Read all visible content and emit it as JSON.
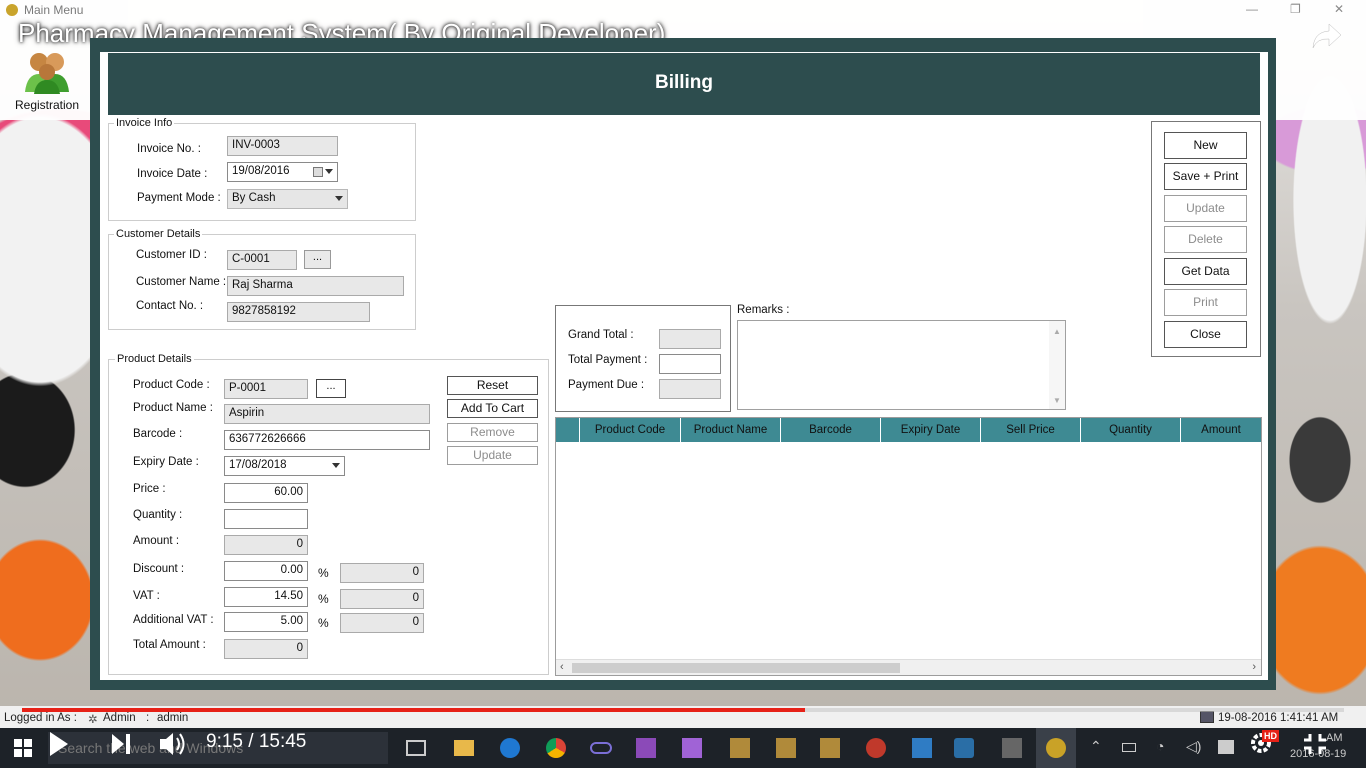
{
  "window": {
    "title": "Main Menu"
  },
  "video": {
    "title": "Pharmacy Management System( By Original Developer)",
    "time": "9:15 / 15:45",
    "hd_badge": "HD",
    "progress": 0.592
  },
  "toolbar": {
    "registration_label": "Registration"
  },
  "dialog": {
    "title": "Billing"
  },
  "invoice_info": {
    "group_title": "Invoice Info",
    "invoice_no_label": "Invoice No. :",
    "invoice_no": "INV-0003",
    "invoice_date_label": "Invoice Date :",
    "invoice_date": "19/08/2016",
    "payment_mode_label": "Payment Mode :",
    "payment_mode": "By Cash"
  },
  "customer_details": {
    "group_title": "Customer Details",
    "customer_id_label": "Customer ID :",
    "customer_id": "C-0001",
    "browse_label": "...",
    "customer_name_label": "Customer Name :",
    "customer_name": "Raj Sharma",
    "contact_label": "Contact No. :",
    "contact": "9827858192"
  },
  "product_details": {
    "group_title": "Product Details",
    "product_code_label": "Product Code :",
    "product_code": "P-0001",
    "browse_label": "...",
    "product_name_label": "Product Name :",
    "product_name": "Aspirin",
    "barcode_label": "Barcode :",
    "barcode": "636772626666",
    "expiry_label": "Expiry Date :",
    "expiry": "17/08/2018",
    "price_label": "Price :",
    "price": "60.00",
    "quantity_label": "Quantity :",
    "quantity": "",
    "amount_label": "Amount :",
    "amount": "0",
    "discount_label": "Discount :",
    "discount": "0.00",
    "discount_amt": "0",
    "vat_label": "VAT  :",
    "vat": "14.50",
    "vat_amt": "0",
    "addl_vat_label": "Additional VAT  :",
    "addl_vat": "5.00",
    "addl_vat_amt": "0",
    "total_label": "Total Amount :",
    "total": "0",
    "percent": "%",
    "reset_label": "Reset",
    "add_label": "Add To Cart",
    "remove_label": "Remove",
    "update_label": "Update"
  },
  "totals": {
    "grand_total_label": "Grand Total :",
    "grand_total": "",
    "total_payment_label": "Total Payment :",
    "total_payment": "",
    "payment_due_label": "Payment Due :",
    "payment_due": "",
    "remarks_label": "Remarks :"
  },
  "actions": {
    "new": "New",
    "save_print": "Save + Print",
    "update": "Update",
    "delete": "Delete",
    "get_data": "Get Data",
    "print": "Print",
    "close": "Close"
  },
  "cart_grid": {
    "columns": [
      "Product Code",
      "Product Name",
      "Barcode",
      "Expiry Date",
      "Sell Price",
      "Quantity",
      "Amount"
    ]
  },
  "status": {
    "logged_in_as": "Logged in As :",
    "role": "Admin",
    "separator": ":",
    "user": "admin",
    "datetime": "19-08-2016  1:41:41 AM"
  },
  "taskbar": {
    "search_placeholder": "Search the web and Windows",
    "clock_time": "AM",
    "clock_date": "2016-08-19"
  },
  "colors": {
    "header_teal": "#2d4d4e",
    "grid_header": "#3e8a93",
    "progress_red": "#e62117"
  }
}
